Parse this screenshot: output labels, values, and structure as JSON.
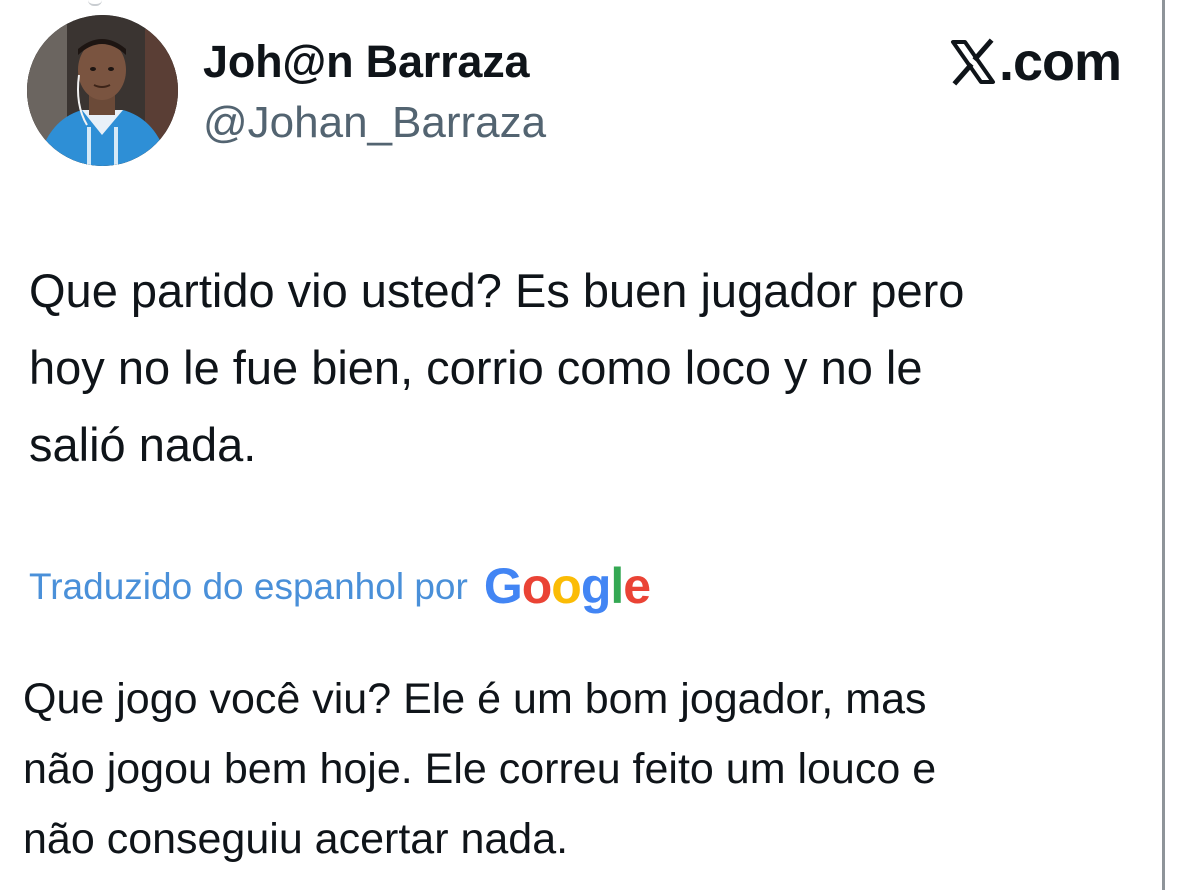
{
  "author": {
    "display_name": "Joh@n Barraza",
    "handle": "@Johan_Barraza"
  },
  "brand": {
    "label": ".com",
    "icon": "x-logo-icon"
  },
  "tweet": {
    "text": "Que partido vio usted? Es buen jugador pero\nhoy no le fue bien, corrio como loco y no le\nsalió nada."
  },
  "translation": {
    "label": "Traduzido do espanhol por",
    "provider": "Google",
    "text": "Que jogo você viu? Ele é um bom jogador, mas\nnão jogou bem hoje. Ele correu feito um louco e\nnão conseguiu acertar nada."
  },
  "colors": {
    "link": "#4a90d9",
    "handle": "#536471",
    "text": "#0f1419"
  }
}
